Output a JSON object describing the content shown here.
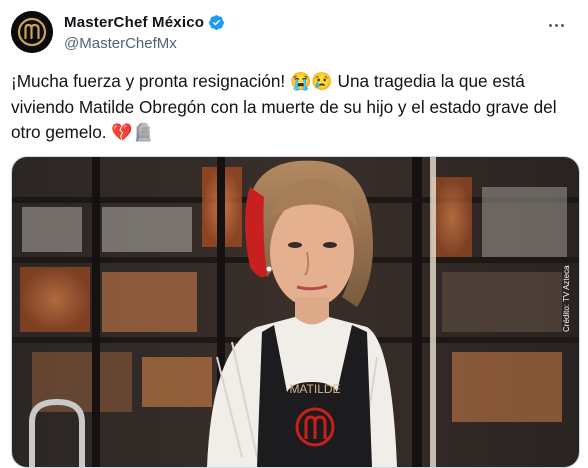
{
  "author": {
    "display_name": "MasterChef México",
    "handle": "@MasterChefMx",
    "verified": true,
    "verified_badge_color": "#1d9bf0",
    "avatar_icon": "masterchef-logo"
  },
  "tweet": {
    "text": "¡Mucha fuerza y pronta resignación! 😭😢 Una tragedia la que está viviendo Matilde Obregón con la muerte de su hijo y el estado grave del otro gemelo. 💔🪦"
  },
  "media": {
    "apron_text": "MATILDE",
    "credit": "Crédito: TV Azteca"
  },
  "colors": {
    "text": "#0f1419",
    "secondary": "#536471",
    "border": "#cfd9de",
    "accent_red": "#c8201e"
  }
}
